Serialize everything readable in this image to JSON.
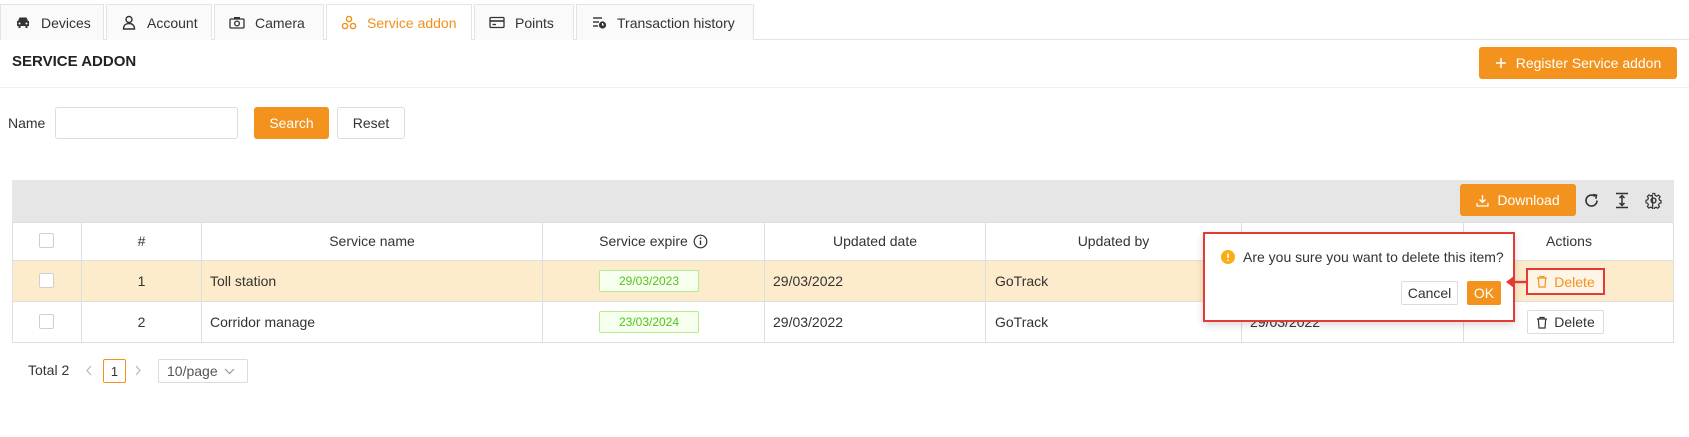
{
  "tabs": [
    {
      "label": "Devices",
      "icon": "car-icon"
    },
    {
      "label": "Account",
      "icon": "user-icon"
    },
    {
      "label": "Camera",
      "icon": "camera-icon"
    },
    {
      "label": "Service addon",
      "icon": "addon-icon",
      "active": true
    },
    {
      "label": "Points",
      "icon": "card-icon"
    },
    {
      "label": "Transaction history",
      "icon": "history-icon"
    }
  ],
  "page": {
    "title": "SERVICE ADDON",
    "register_button": "Register Service addon"
  },
  "filter": {
    "name_label": "Name",
    "name_value": "",
    "search_button": "Search",
    "reset_button": "Reset"
  },
  "toolbar": {
    "download_button": "Download"
  },
  "table": {
    "columns": [
      "#",
      "Service name",
      "Service expire",
      "Updated date",
      "Updated by",
      "",
      "Actions"
    ],
    "rows": [
      {
        "index": "1",
        "service_name": "Toll station",
        "service_expire": "29/03/2023",
        "updated_date": "29/03/2022",
        "updated_by": "GoTrack",
        "created_date": "",
        "action": "Delete",
        "highlighted": true
      },
      {
        "index": "2",
        "service_name": "Corridor manage",
        "service_expire": "23/03/2024",
        "updated_date": "29/03/2022",
        "updated_by": "GoTrack",
        "created_date": "29/03/2022",
        "action": "Delete",
        "highlighted": false
      }
    ]
  },
  "pagination": {
    "total_label": "Total 2",
    "current_page": "1",
    "page_size": "10/page"
  },
  "popconfirm": {
    "message": "Are you sure you want to delete this item?",
    "cancel": "Cancel",
    "ok": "OK"
  },
  "colors": {
    "accent": "#f3921c",
    "highlight_row": "#fdeccb",
    "tag_green": "#52c41a",
    "annotation_red": "#e53935"
  }
}
